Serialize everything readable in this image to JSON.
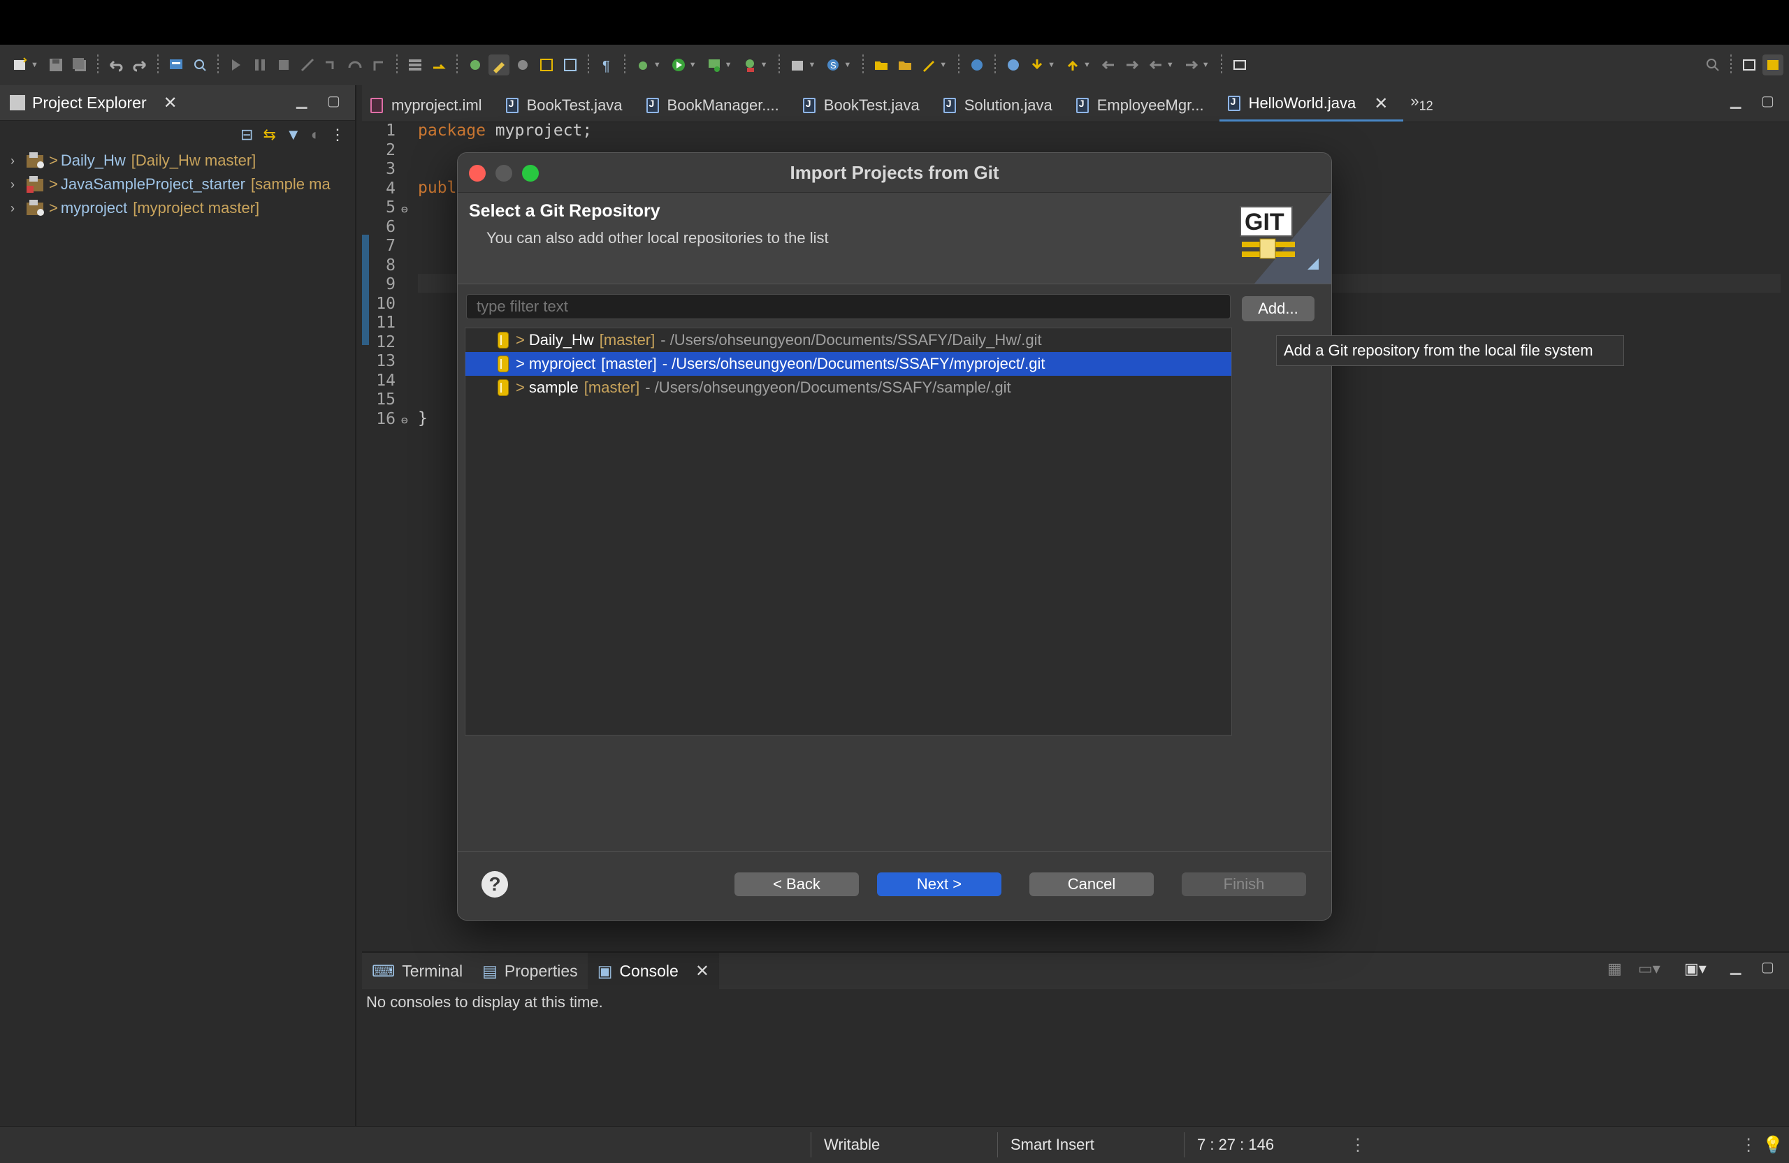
{
  "explorer": {
    "title": "Project Explorer",
    "projects": [
      {
        "name": "Daily_Hw",
        "decoration": "[Daily_Hw master]"
      },
      {
        "name": "JavaSampleProject_starter",
        "decoration": "[sample ma"
      },
      {
        "name": "myproject",
        "decoration": "[myproject master]"
      }
    ]
  },
  "editor": {
    "tabs": [
      {
        "label": "myproject.iml",
        "kind": "iml"
      },
      {
        "label": "BookTest.java",
        "kind": "java"
      },
      {
        "label": "BookManager....",
        "kind": "java"
      },
      {
        "label": "BookTest.java",
        "kind": "java"
      },
      {
        "label": "Solution.java",
        "kind": "java"
      },
      {
        "label": "EmployeeMgr...",
        "kind": "java"
      },
      {
        "label": "HelloWorld.java",
        "kind": "java",
        "active": true
      }
    ],
    "overflow_count": "12",
    "line_numbers": [
      "1",
      "2",
      "3",
      "4",
      "5",
      "6",
      "7",
      "8",
      "9",
      "10",
      "11",
      "12",
      "13",
      "14",
      "15",
      "16"
    ],
    "code": {
      "line1_kw": "package",
      "line1_rest": " myproject;",
      "line4": "publ",
      "line16": "}"
    }
  },
  "bottom": {
    "tabs": [
      "Terminal",
      "Properties",
      "Console"
    ],
    "message": "No consoles to display at this time."
  },
  "status": {
    "writable": "Writable",
    "insert_mode": "Smart Insert",
    "position": "7 : 27 : 146"
  },
  "dialog": {
    "title": "Import Projects from Git",
    "header_title": "Select a Git Repository",
    "header_desc": "You can also add other local repositories to the list",
    "logo_text": "GIT",
    "filter_placeholder": "type filter text",
    "add_label": "Add...",
    "repos": [
      {
        "name": "Daily_Hw",
        "branch": "[master]",
        "path": "- /Users/ohseungyeon/Documents/SSAFY/Daily_Hw/.git"
      },
      {
        "name": "myproject",
        "branch": "[master]",
        "path": "- /Users/ohseungyeon/Documents/SSAFY/myproject/.git",
        "selected": true
      },
      {
        "name": "sample",
        "branch": "[master]",
        "path": "- /Users/ohseungyeon/Documents/SSAFY/sample/.git"
      }
    ],
    "buttons": {
      "help": "?",
      "back": "< Back",
      "next": "Next >",
      "cancel": "Cancel",
      "finish": "Finish"
    }
  },
  "tooltip": "Add a Git repository from the local file system",
  "colors": {
    "selection": "#2152c7",
    "primary_button": "#2864d8",
    "decoration": "#c9a45c",
    "keyword": "#cc7832"
  }
}
